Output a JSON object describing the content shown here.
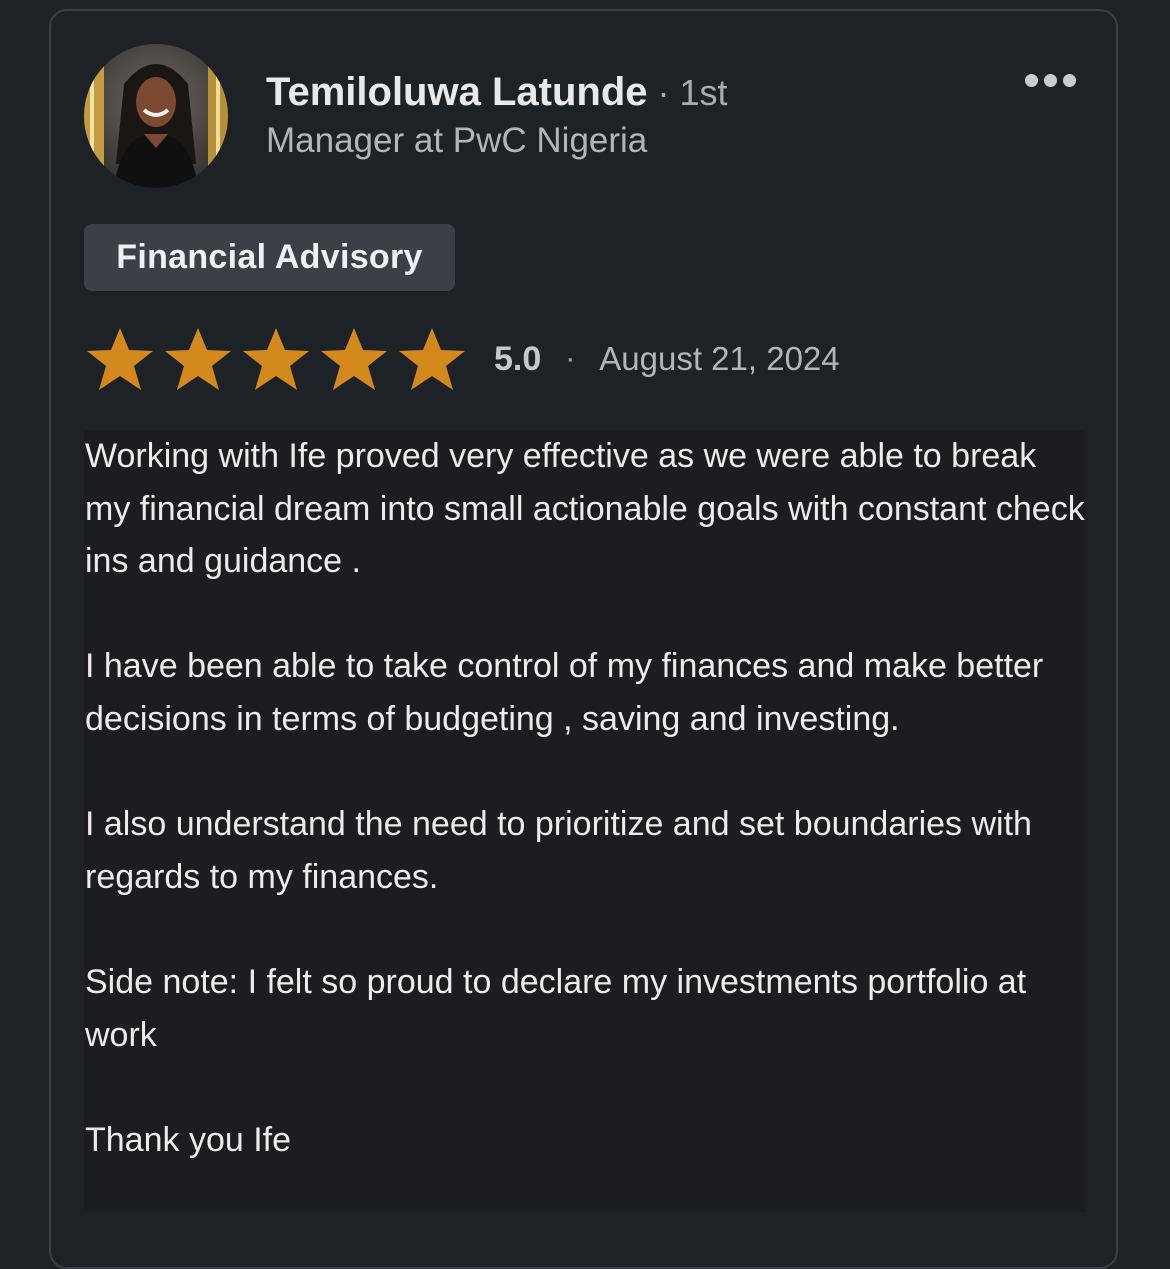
{
  "review": {
    "author": {
      "name": "Temiloluwa Latunde",
      "connection_degree": "· 1st",
      "headline": "Manager at PwC Nigeria"
    },
    "more_icon": "more-horizontal-icon",
    "service_tag": "Financial Advisory",
    "rating": {
      "stars": 5,
      "max_stars": 5,
      "star_color": "#d4891c",
      "value": "5.0",
      "separator": "·",
      "date": "August 21, 2024"
    },
    "paragraphs": [
      "Working with Ife proved very effective as we were able to break my financial dream into small actionable goals with constant check ins and guidance .",
      "I have been able to take control of my finances and make better decisions in terms of budgeting , saving and investing.",
      "I also understand the need to prioritize and set boundaries with regards to my finances.",
      "Side note: I felt so proud to declare my investments portfolio at work",
      "Thank you Ife"
    ]
  },
  "colors": {
    "background": "#1d2226",
    "card_border": "#3a4046",
    "tag_background": "#3a4045",
    "body_highlight": "#1b1d21"
  }
}
